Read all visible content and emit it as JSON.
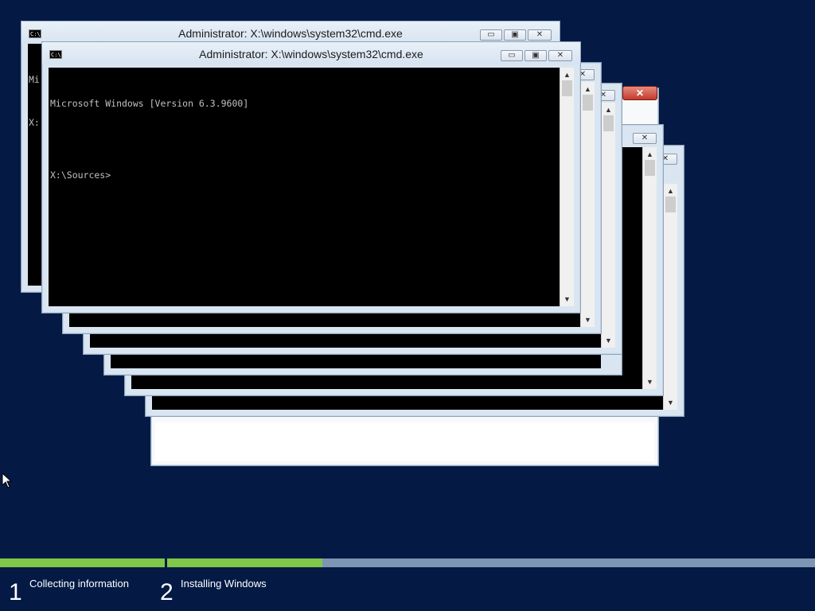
{
  "windows": {
    "title": "Administrator: X:\\windows\\system32\\cmd.exe",
    "icon": "cmd-icon",
    "minimize_glyph": "▭",
    "maximize_glyph": "▣",
    "close_glyph": "✕",
    "console_lines": [
      "Microsoft Windows [Version 6.3.9600]",
      "",
      "X:\\Sources>"
    ],
    "peek_text_1": "Mi",
    "peek_text_2": "X:"
  },
  "dialog_close_glyph": "✕",
  "setup": {
    "steps": [
      {
        "number": "1",
        "label": "Collecting information"
      },
      {
        "number": "2",
        "label": "Installing Windows"
      }
    ],
    "progress": {
      "step1_fraction": 1.0,
      "step2_fraction": 0.24
    },
    "colors": {
      "progress_fill": "#7fc84a",
      "progress_track": "#7d96b4",
      "background": "#041a45"
    }
  }
}
